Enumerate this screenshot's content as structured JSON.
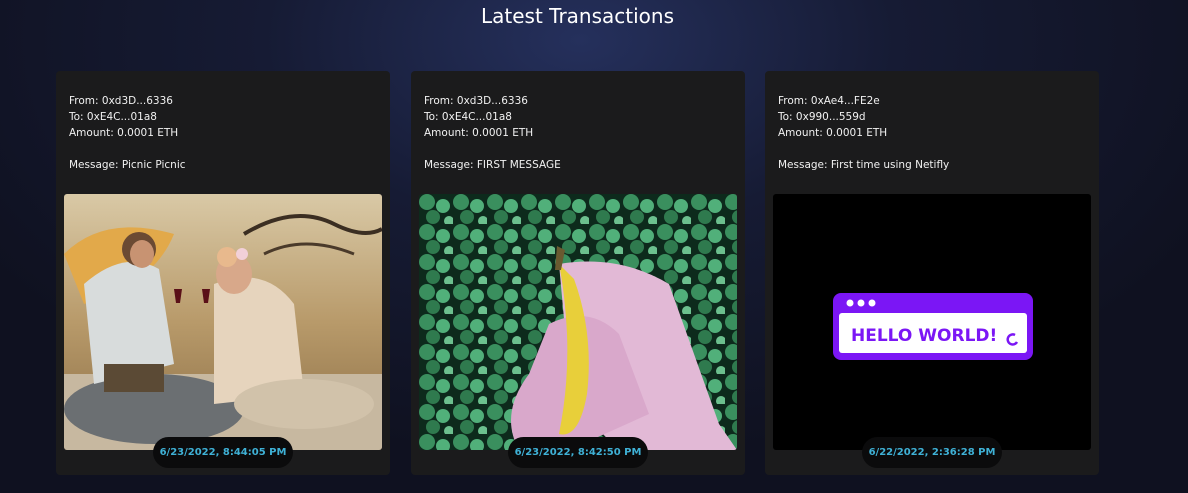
{
  "page": {
    "title": "Latest Transactions"
  },
  "transactions": [
    {
      "from": "From: 0xd3D...6336",
      "to": "To: 0xE4C...01a8",
      "amount": "Amount: 0.0001 ETH",
      "message": "Message: Picnic Picnic",
      "timestamp": "6/23/2022, 8:44:05 PM",
      "image": "picnic-couple-gif"
    },
    {
      "from": "From: 0xd3D...6336",
      "to": "To: 0xE4C...01a8",
      "amount": "Amount: 0.0001 ETH",
      "message": "Message: FIRST MESSAGE",
      "timestamp": "6/23/2022, 8:42:50 PM",
      "image": "banana-hands-gif"
    },
    {
      "from": "From: 0xAe4...FE2e",
      "to": "To: 0x990...559d",
      "amount": "Amount: 0.0001 ETH",
      "message": "Message: First time using Netifly",
      "timestamp": "6/22/2022, 2:36:28 PM",
      "image": "hello-world-window-gif",
      "image_text": "HELLO WORLD!"
    }
  ],
  "colors": {
    "accent": "#3fb1d6",
    "card": "#1b1b1c",
    "hello_purple": "#7b16f5"
  }
}
